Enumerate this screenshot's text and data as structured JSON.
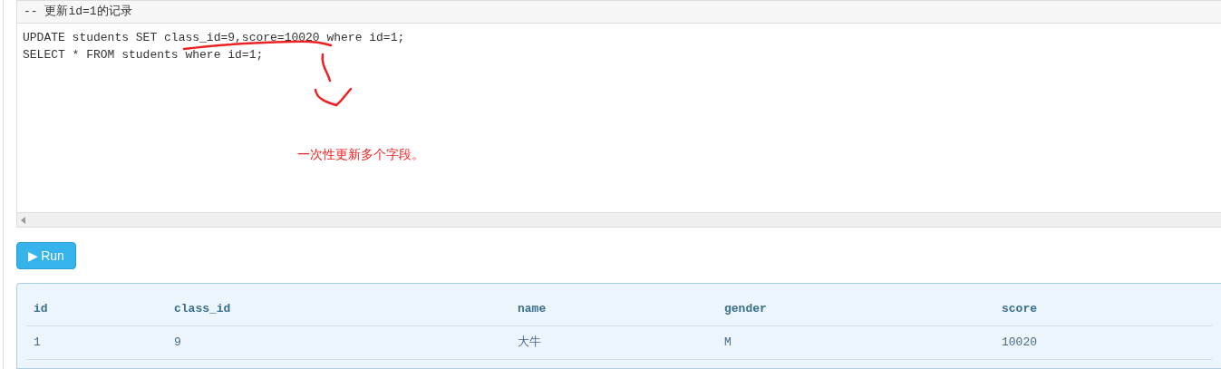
{
  "comment": "-- 更新id=1的记录",
  "code_lines": [
    "UPDATE students SET class_id=9,score=10020 where id=1;",
    "SELECT * FROM students where id=1;"
  ],
  "annotation": "一次性更新多个字段。",
  "run_button": {
    "icon": "▶",
    "label": "Run"
  },
  "table": {
    "columns": [
      "id",
      "class_id",
      "name",
      "gender",
      "score"
    ],
    "rows": [
      [
        "1",
        "9",
        "大牛",
        "M",
        "10020"
      ]
    ]
  }
}
